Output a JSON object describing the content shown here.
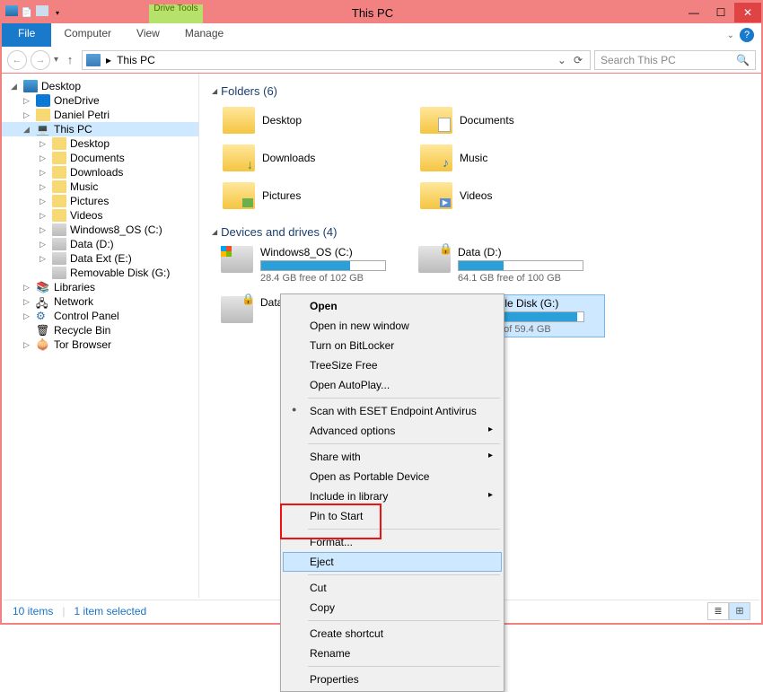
{
  "window": {
    "title": "This PC",
    "drive_tools_label": "Drive Tools"
  },
  "tabs": {
    "file": "File",
    "computer": "Computer",
    "view": "View",
    "manage": "Manage"
  },
  "address": {
    "location": "This PC",
    "search_placeholder": "Search This PC"
  },
  "tree": {
    "desktop": "Desktop",
    "onedrive": "OneDrive",
    "user": "Daniel Petri",
    "thispc": "This PC",
    "sub": {
      "desktop": "Desktop",
      "documents": "Documents",
      "downloads": "Downloads",
      "music": "Music",
      "pictures": "Pictures",
      "videos": "Videos",
      "drive_c": "Windows8_OS (C:)",
      "drive_d": "Data (D:)",
      "drive_e": "Data Ext (E:)",
      "drive_g": "Removable Disk (G:)"
    },
    "libraries": "Libraries",
    "network": "Network",
    "cpanel": "Control Panel",
    "recycle": "Recycle Bin",
    "tor": "Tor Browser"
  },
  "sections": {
    "folders": "Folders (6)",
    "drives": "Devices and drives (4)"
  },
  "folders": {
    "desktop": "Desktop",
    "documents": "Documents",
    "downloads": "Downloads",
    "music": "Music",
    "pictures": "Pictures",
    "videos": "Videos"
  },
  "drives": {
    "c": {
      "name": "Windows8_OS (C:)",
      "free": "28.4 GB free of 102 GB",
      "pct": 72
    },
    "d": {
      "name": "Data (D:)",
      "free": "64.1 GB free of 100 GB",
      "pct": 36
    },
    "e": {
      "name": "Data Ext (E:)",
      "free": "",
      "pct": 0
    },
    "g": {
      "name": "Removable Disk (G:)",
      "free": "3 GB free of 59.4 GB",
      "pct": 95
    }
  },
  "context_menu": {
    "open": "Open",
    "open_new": "Open in new window",
    "bitlocker": "Turn on BitLocker",
    "treesize": "TreeSize Free",
    "autoplay": "Open AutoPlay...",
    "eset": "Scan with ESET Endpoint Antivirus",
    "advanced": "Advanced options",
    "share": "Share with",
    "portable": "Open as Portable Device",
    "include_lib": "Include in library",
    "pin_start": "Pin to Start",
    "format": "Format...",
    "eject": "Eject",
    "cut": "Cut",
    "copy": "Copy",
    "shortcut": "Create shortcut",
    "rename": "Rename",
    "properties": "Properties"
  },
  "status": {
    "items": "10 items",
    "selected": "1 item selected"
  }
}
